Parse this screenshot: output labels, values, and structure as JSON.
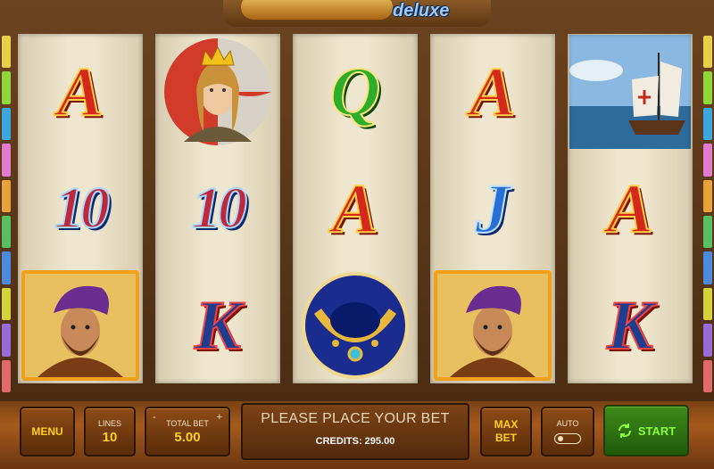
{
  "logo": {
    "subtitle": "deluxe"
  },
  "reels": [
    [
      {
        "symbol": "letter",
        "text": "A",
        "style": "red"
      },
      {
        "symbol": "letter",
        "text": "10",
        "style": "ten"
      },
      {
        "symbol": "explorer-portrait"
      }
    ],
    [
      {
        "symbol": "queen-portrait"
      },
      {
        "symbol": "letter",
        "text": "10",
        "style": "ten"
      },
      {
        "symbol": "letter",
        "text": "K",
        "style": "k"
      }
    ],
    [
      {
        "symbol": "letter",
        "text": "Q",
        "style": "green"
      },
      {
        "symbol": "letter",
        "text": "A",
        "style": "red"
      },
      {
        "symbol": "necklace"
      }
    ],
    [
      {
        "symbol": "letter",
        "text": "A",
        "style": "red"
      },
      {
        "symbol": "letter",
        "text": "J",
        "style": "blue"
      },
      {
        "symbol": "explorer-portrait"
      }
    ],
    [
      {
        "symbol": "ship"
      },
      {
        "symbol": "letter",
        "text": "A",
        "style": "red"
      },
      {
        "symbol": "letter",
        "text": "K",
        "style": "k"
      }
    ]
  ],
  "controls": {
    "menu": "MENU",
    "lines_label": "LINES",
    "lines_value": "10",
    "minus": "-",
    "plus": "+",
    "total_bet_label": "TOTAL BET",
    "total_bet_value": "5.00",
    "message": "PLEASE PLACE YOUR BET",
    "credits": "CREDITS: 295.00",
    "max_bet_line1": "MAX",
    "max_bet_line2": "BET",
    "auto_label": "AUTO",
    "auto_on": false,
    "start": "START"
  },
  "colors": {
    "gold_text": "#ffd11a",
    "start_green": "#8cff3a",
    "side_tabs": [
      "#e8d04a",
      "#8fd63a",
      "#3aa7e0",
      "#e07bd0",
      "#e8a23a",
      "#58c060",
      "#4a8ae0",
      "#d4d43a",
      "#9a6ad8",
      "#e06a6a"
    ]
  }
}
